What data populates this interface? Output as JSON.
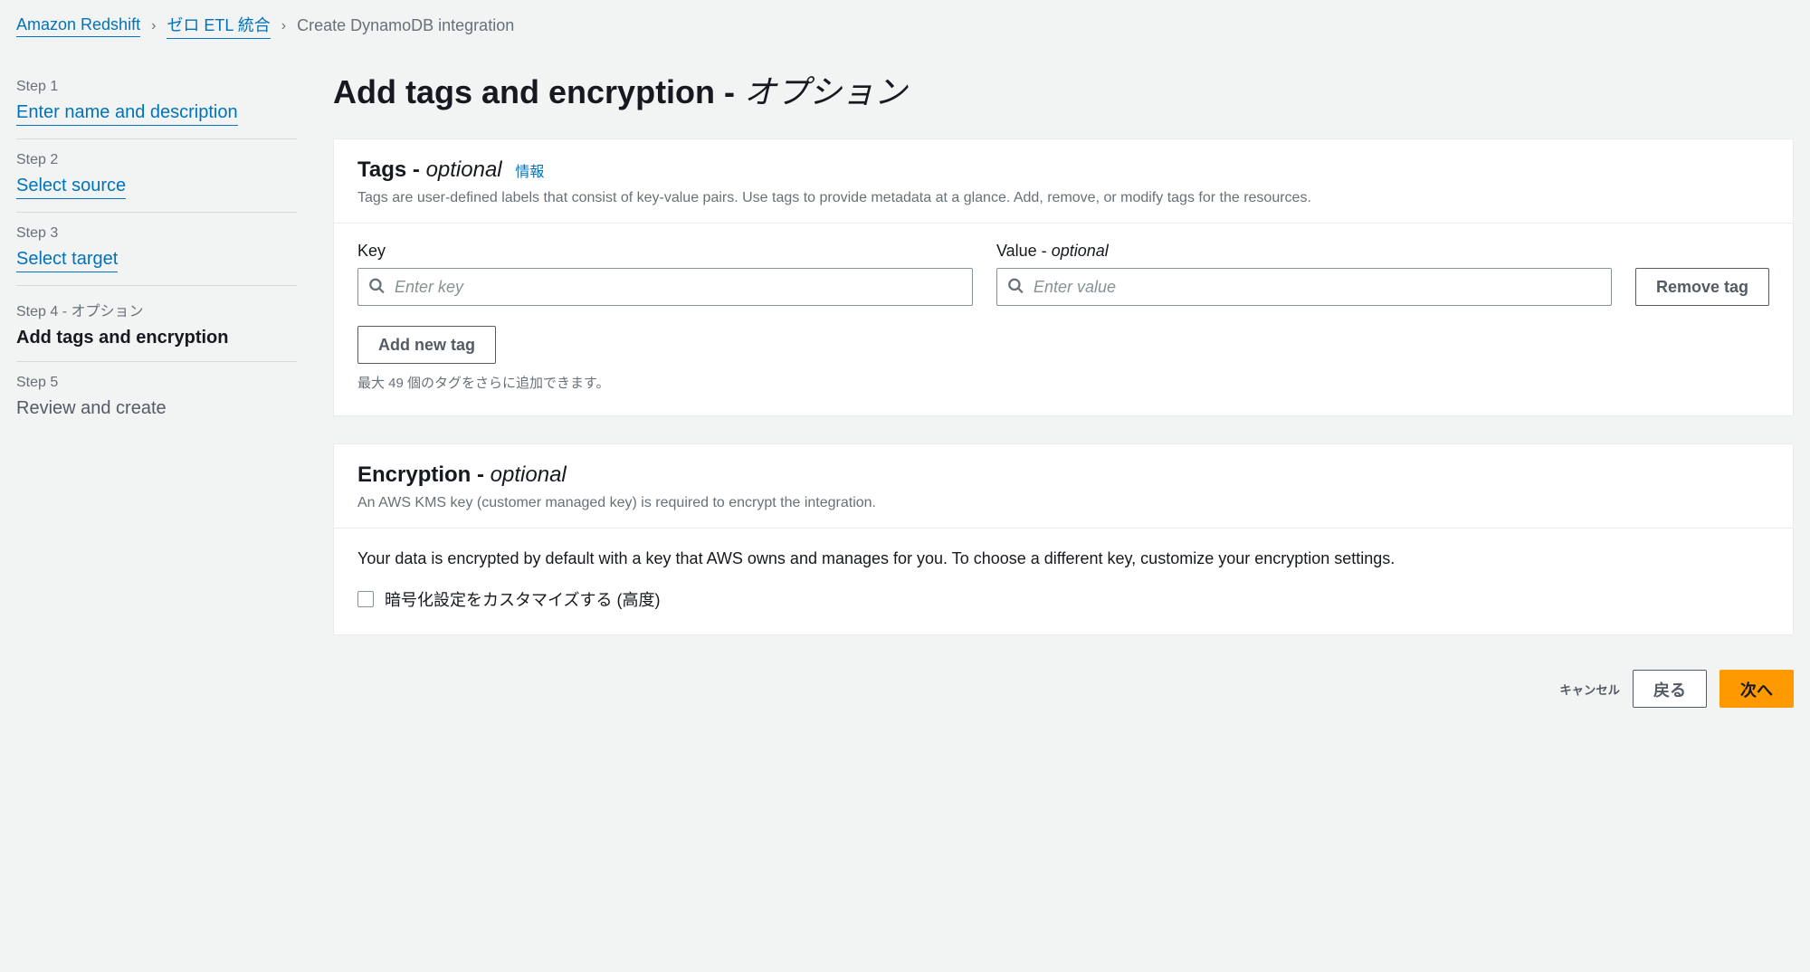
{
  "breadcrumb": {
    "items": [
      {
        "label": "Amazon Redshift",
        "link": true
      },
      {
        "label": "ゼロ ETL 統合",
        "link": true
      },
      {
        "label": "Create DynamoDB integration",
        "link": false
      }
    ]
  },
  "sidebar": {
    "steps": [
      {
        "label": "Step 1",
        "title": "Enter name and description",
        "link": true
      },
      {
        "label": "Step 2",
        "title": "Select source",
        "link": true
      },
      {
        "label": "Step 3",
        "title": "Select target",
        "link": true
      },
      {
        "label": "Step 4 - オプション",
        "title": "Add tags and encryption",
        "active": true
      },
      {
        "label": "Step 5",
        "title": "Review and create"
      }
    ]
  },
  "page": {
    "title_prefix": "Add tags and encryption - ",
    "title_suffix": "オプション"
  },
  "tags_panel": {
    "title": "Tags - ",
    "title_optional": "optional",
    "info": "情報",
    "desc": "Tags are user-defined labels that consist of key-value pairs. Use tags to provide metadata at a glance. Add, remove, or modify tags for the resources.",
    "key_label": "Key",
    "key_placeholder": "Enter key",
    "value_label": "Value - ",
    "value_optional": "optional",
    "value_placeholder": "Enter value",
    "remove_btn": "Remove tag",
    "add_btn": "Add new tag",
    "hint": "最大 49 個のタグをさらに追加できます。"
  },
  "encryption_panel": {
    "title": "Encryption - ",
    "title_optional": "optional",
    "desc": "An AWS KMS key (customer managed key) is required to encrypt the integration.",
    "body": "Your data is encrypted by default with a key that AWS owns and manages for you. To choose a different key, customize your encryption settings.",
    "checkbox_label": "暗号化設定をカスタマイズする (高度)"
  },
  "footer": {
    "cancel": "キャンセル",
    "back": "戻る",
    "next": "次へ"
  }
}
